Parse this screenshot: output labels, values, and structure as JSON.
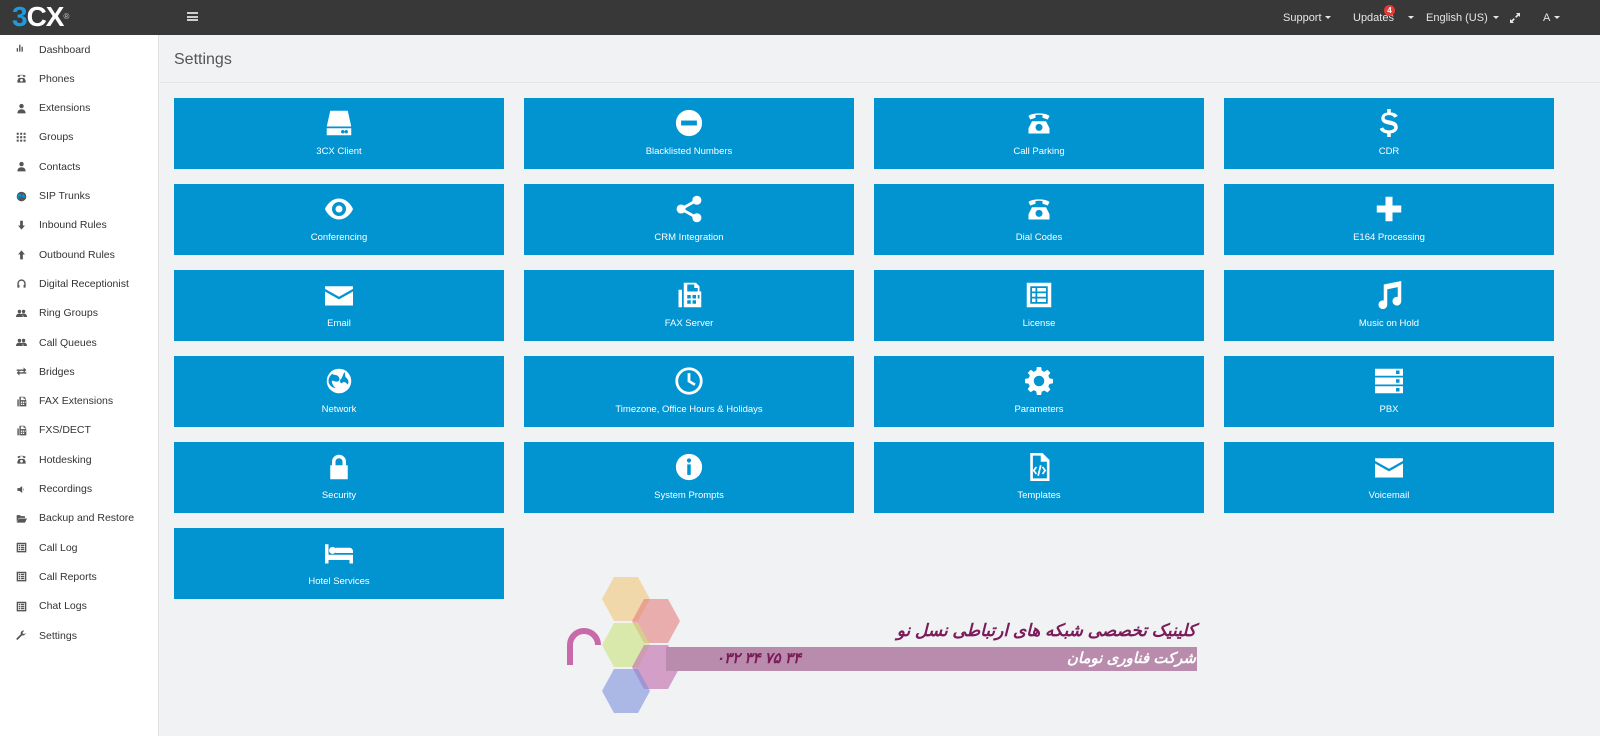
{
  "topbar": {
    "logo_main": "CX",
    "logo_three": "3",
    "logo_reg": "®",
    "support_label": "Support",
    "updates_label": "Updates",
    "updates_badge": "4",
    "language_label": "English (US)",
    "user_label": "A"
  },
  "sidebar": {
    "items": [
      {
        "label": "Dashboard",
        "icon": "bar-chart-icon"
      },
      {
        "label": "Phones",
        "icon": "phone-icon"
      },
      {
        "label": "Extensions",
        "icon": "user-icon"
      },
      {
        "label": "Groups",
        "icon": "grid-icon"
      },
      {
        "label": "Contacts",
        "icon": "user-icon"
      },
      {
        "label": "SIP Trunks",
        "icon": "globe-icon"
      },
      {
        "label": "Inbound Rules",
        "icon": "arrow-down-icon"
      },
      {
        "label": "Outbound Rules",
        "icon": "arrow-up-icon"
      },
      {
        "label": "Digital Receptionist",
        "icon": "headphones-icon"
      },
      {
        "label": "Ring Groups",
        "icon": "users-icon"
      },
      {
        "label": "Call Queues",
        "icon": "users-icon"
      },
      {
        "label": "Bridges",
        "icon": "exchange-icon"
      },
      {
        "label": "FAX Extensions",
        "icon": "fax-icon"
      },
      {
        "label": "FXS/DECT",
        "icon": "fax-icon"
      },
      {
        "label": "Hotdesking",
        "icon": "phone-icon"
      },
      {
        "label": "Recordings",
        "icon": "volume-icon"
      },
      {
        "label": "Backup and Restore",
        "icon": "folder-open-icon"
      },
      {
        "label": "Call Log",
        "icon": "list-alt-icon"
      },
      {
        "label": "Call Reports",
        "icon": "list-alt-icon"
      },
      {
        "label": "Chat Logs",
        "icon": "list-alt-icon"
      },
      {
        "label": "Settings",
        "icon": "wrench-icon"
      }
    ]
  },
  "main": {
    "title": "Settings",
    "tiles": [
      {
        "label": "3CX Client",
        "icon": "hdd-icon"
      },
      {
        "label": "Blacklisted Numbers",
        "icon": "minus-circle-icon"
      },
      {
        "label": "Call Parking",
        "icon": "phone-icon"
      },
      {
        "label": "CDR",
        "icon": "dollar-icon"
      },
      {
        "label": "Conferencing",
        "icon": "eye-icon"
      },
      {
        "label": "CRM Integration",
        "icon": "share-icon"
      },
      {
        "label": "Dial Codes",
        "icon": "phone-icon"
      },
      {
        "label": "E164 Processing",
        "icon": "plus-icon"
      },
      {
        "label": "Email",
        "icon": "envelope-icon"
      },
      {
        "label": "FAX Server",
        "icon": "fax-icon"
      },
      {
        "label": "License",
        "icon": "list-alt-icon"
      },
      {
        "label": "Music on Hold",
        "icon": "music-icon"
      },
      {
        "label": "Network",
        "icon": "globe-icon"
      },
      {
        "label": "Timezone, Office Hours & Holidays",
        "icon": "clock-icon"
      },
      {
        "label": "Parameters",
        "icon": "gear-icon"
      },
      {
        "label": "PBX",
        "icon": "server-icon"
      },
      {
        "label": "Security",
        "icon": "lock-icon"
      },
      {
        "label": "System Prompts",
        "icon": "info-circle-icon"
      },
      {
        "label": "Templates",
        "icon": "file-code-icon"
      },
      {
        "label": "Voicemail",
        "icon": "envelope-icon"
      },
      {
        "label": "Hotel Services",
        "icon": "bed-icon"
      }
    ]
  },
  "watermark": {
    "line1": "کلینیک تخصصی شبکه های ارتباطی نسل نو",
    "line2": "شرکت فناوری نومان",
    "phone": "۰۳۲ ۳۴ ۷۵ ۳۴"
  }
}
